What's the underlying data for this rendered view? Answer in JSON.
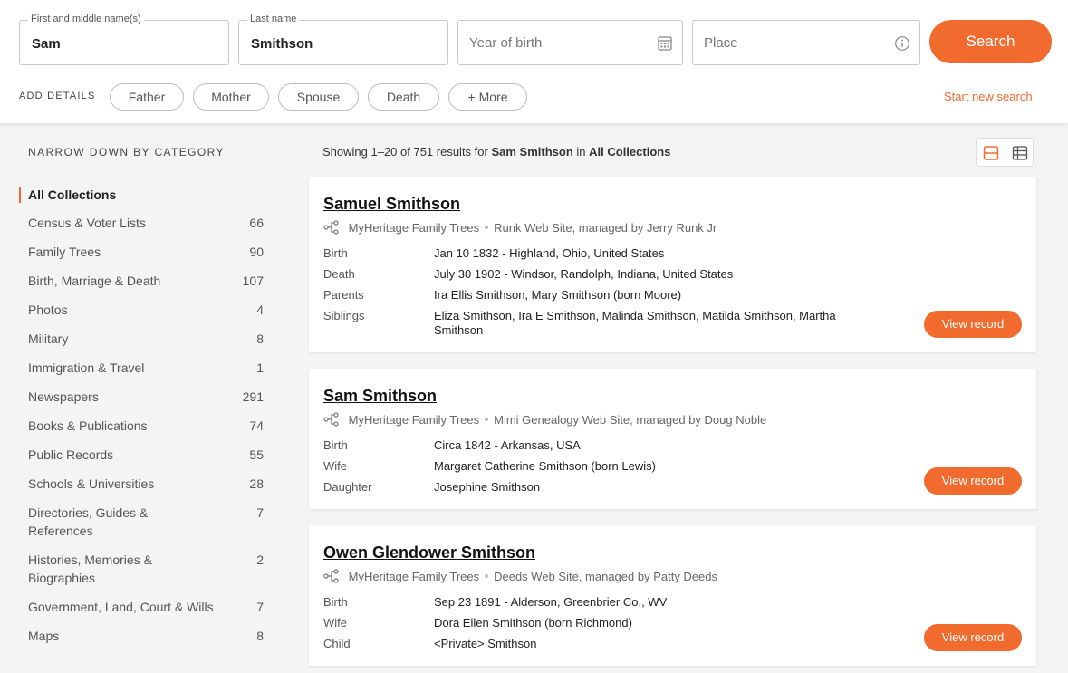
{
  "search": {
    "first_label": "First and middle name(s)",
    "first_value": "Sam",
    "last_label": "Last name",
    "last_value": "Smithson",
    "year_placeholder": "Year of birth",
    "place_placeholder": "Place",
    "search_label": "Search",
    "add_details_label": "ADD DETAILS",
    "chips": [
      "Father",
      "Mother",
      "Spouse",
      "Death",
      "+ More"
    ],
    "start_new": "Start new search",
    "accent_color": "#f26b2e"
  },
  "sidebar": {
    "title": "NARROW DOWN BY CATEGORY",
    "active": "All Collections",
    "categories": [
      {
        "label": "Census & Voter Lists",
        "count": "66"
      },
      {
        "label": "Family Trees",
        "count": "90"
      },
      {
        "label": "Birth, Marriage & Death",
        "count": "107"
      },
      {
        "label": "Photos",
        "count": "4"
      },
      {
        "label": "Military",
        "count": "8"
      },
      {
        "label": "Immigration & Travel",
        "count": "1"
      },
      {
        "label": "Newspapers",
        "count": "291"
      },
      {
        "label": "Books & Publications",
        "count": "74"
      },
      {
        "label": "Public Records",
        "count": "55"
      },
      {
        "label": "Schools & Universities",
        "count": "28"
      },
      {
        "label": "Directories, Guides & References",
        "count": "7"
      },
      {
        "label": "Histories, Memories & Biographies",
        "count": "2"
      },
      {
        "label": "Government, Land, Court & Wills",
        "count": "7"
      },
      {
        "label": "Maps",
        "count": "8"
      }
    ]
  },
  "results": {
    "showing_prefix": "Showing 1–20 of 751 results for",
    "query": "Sam Smithson",
    "in_text": "in",
    "collection": "All Collections",
    "view_record_label": "View record",
    "items": [
      {
        "name": "Samuel Smithson",
        "source": "MyHeritage Family Trees",
        "site": "Runk Web Site, managed by Jerry Runk Jr",
        "rows": [
          {
            "label": "Birth",
            "value": "Jan 10 1832 - Highland, Ohio, United States"
          },
          {
            "label": "Death",
            "value": "July 30 1902 - Windsor, Randolph, Indiana, United States"
          },
          {
            "label": "Parents",
            "value": "Ira Ellis Smithson, Mary Smithson (born Moore)"
          },
          {
            "label": "Siblings",
            "value": "Eliza Smithson, Ira E Smithson, Malinda Smithson, Matilda Smithson, Martha Smithson"
          }
        ]
      },
      {
        "name": "Sam Smithson",
        "source": "MyHeritage Family Trees",
        "site": "Mimi Genealogy Web Site, managed by Doug Noble",
        "rows": [
          {
            "label": "Birth",
            "value": "Circa 1842 - Arkansas, USA"
          },
          {
            "label": "Wife",
            "value": "Margaret Catherine Smithson (born Lewis)"
          },
          {
            "label": "Daughter",
            "value": "Josephine Smithson"
          }
        ]
      },
      {
        "name": "Owen Glendower Smithson",
        "source": "MyHeritage Family Trees",
        "site": "Deeds Web Site, managed by Patty Deeds",
        "rows": [
          {
            "label": "Birth",
            "value": "Sep 23 1891 - Alderson, Greenbrier Co., WV"
          },
          {
            "label": "Wife",
            "value": "Dora Ellen Smithson (born Richmond)"
          },
          {
            "label": "Child",
            "value": "<Private> Smithson"
          }
        ]
      }
    ]
  }
}
